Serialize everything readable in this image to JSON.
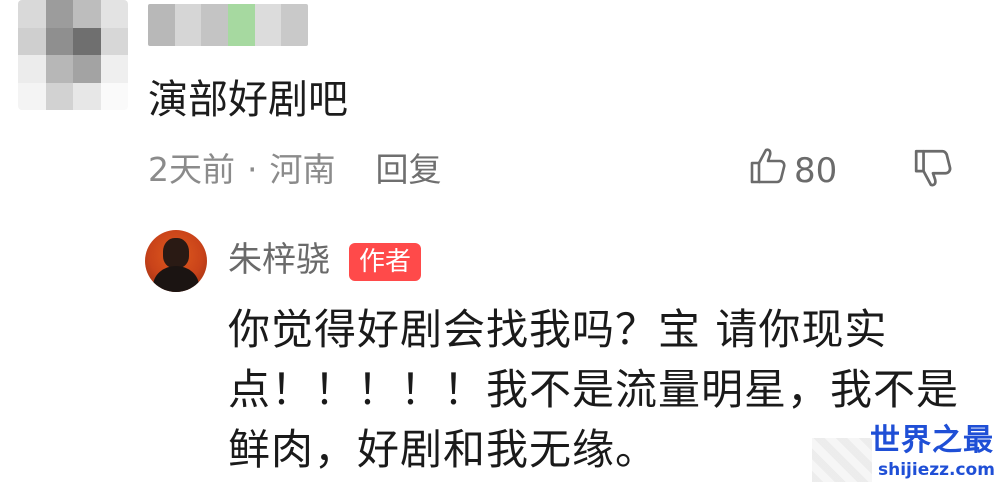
{
  "top_comment": {
    "avatar_icon": "user-avatar-pixelated",
    "text": "演部好剧吧",
    "time": "2天前",
    "dot": "·",
    "location": "河南",
    "reply_label": "回复",
    "like_icon": "thumbs-up-icon",
    "like_count": "80",
    "dislike_icon": "thumbs-down-icon"
  },
  "author_reply": {
    "avatar_icon": "author-avatar",
    "name": "朱梓骁",
    "badge": "作者",
    "text": "你觉得好剧会找我吗？宝 请你现实\n点！！！！！我不是流量明星，我不是\n鲜肉，好剧和我无缘。"
  },
  "watermark": {
    "title": "世界之最",
    "site": "shijiezz.com"
  },
  "colors": {
    "badge": "#ff4a4a",
    "meta_text": "#8b8b8b",
    "watermark": "#1f4fd6"
  }
}
